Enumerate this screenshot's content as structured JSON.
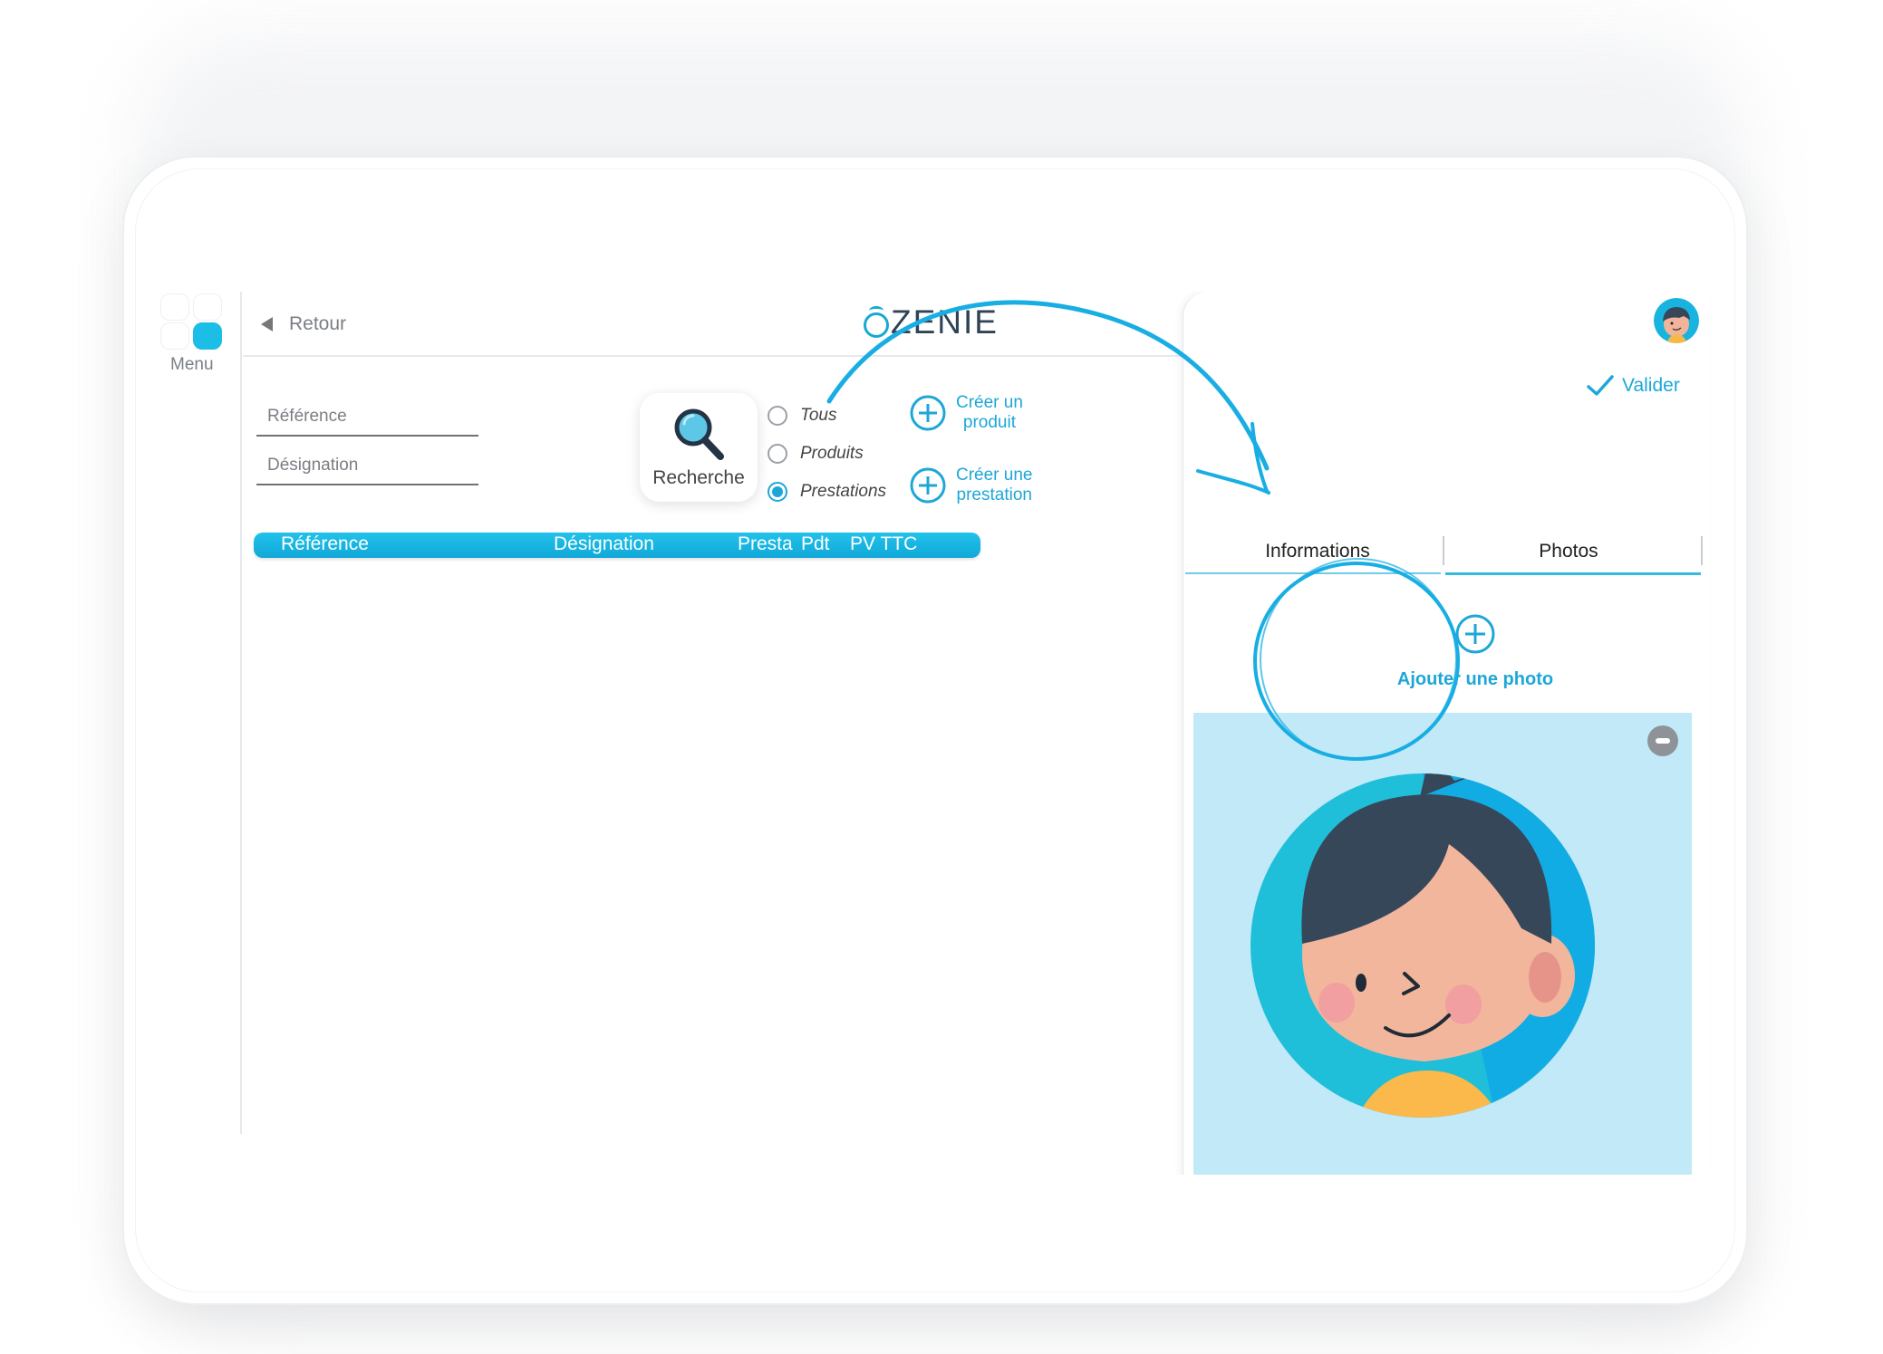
{
  "sidebar": {
    "menu_label": "Menu"
  },
  "header": {
    "back_label": "Retour",
    "logo_text": "ZENIE"
  },
  "search": {
    "reference_placeholder": "Référence",
    "designation_placeholder": "Désignation",
    "button_label": "Recherche"
  },
  "filters": [
    {
      "label": "Tous",
      "checked": false
    },
    {
      "label": "Produits",
      "checked": false
    },
    {
      "label": "Prestations",
      "checked": true
    }
  ],
  "create": {
    "product_line1": "Créer un",
    "product_line2": "produit",
    "service_line1": "Créer une",
    "service_line2": "prestation"
  },
  "table": {
    "columns": [
      "Référence",
      "Désignation",
      "Presta",
      "Pdt",
      "PV TTC"
    ]
  },
  "panel": {
    "validate_label": "Valider",
    "tabs": [
      "Informations",
      "Photos"
    ],
    "active_tab": "Photos",
    "add_photo_label": "Ajouter une photo"
  },
  "icons": {
    "menu": "grid-icon",
    "back": "back-arrow-icon",
    "search": "magnifier-icon",
    "create": "plus-circle-icon",
    "validate": "checkmark-icon",
    "remove": "minus-circle-icon"
  },
  "colors": {
    "accent": "#1da7d8",
    "table_header": "#10a8d8",
    "photo_background": "#c2e9f8",
    "logo_text": "#2f4356"
  }
}
